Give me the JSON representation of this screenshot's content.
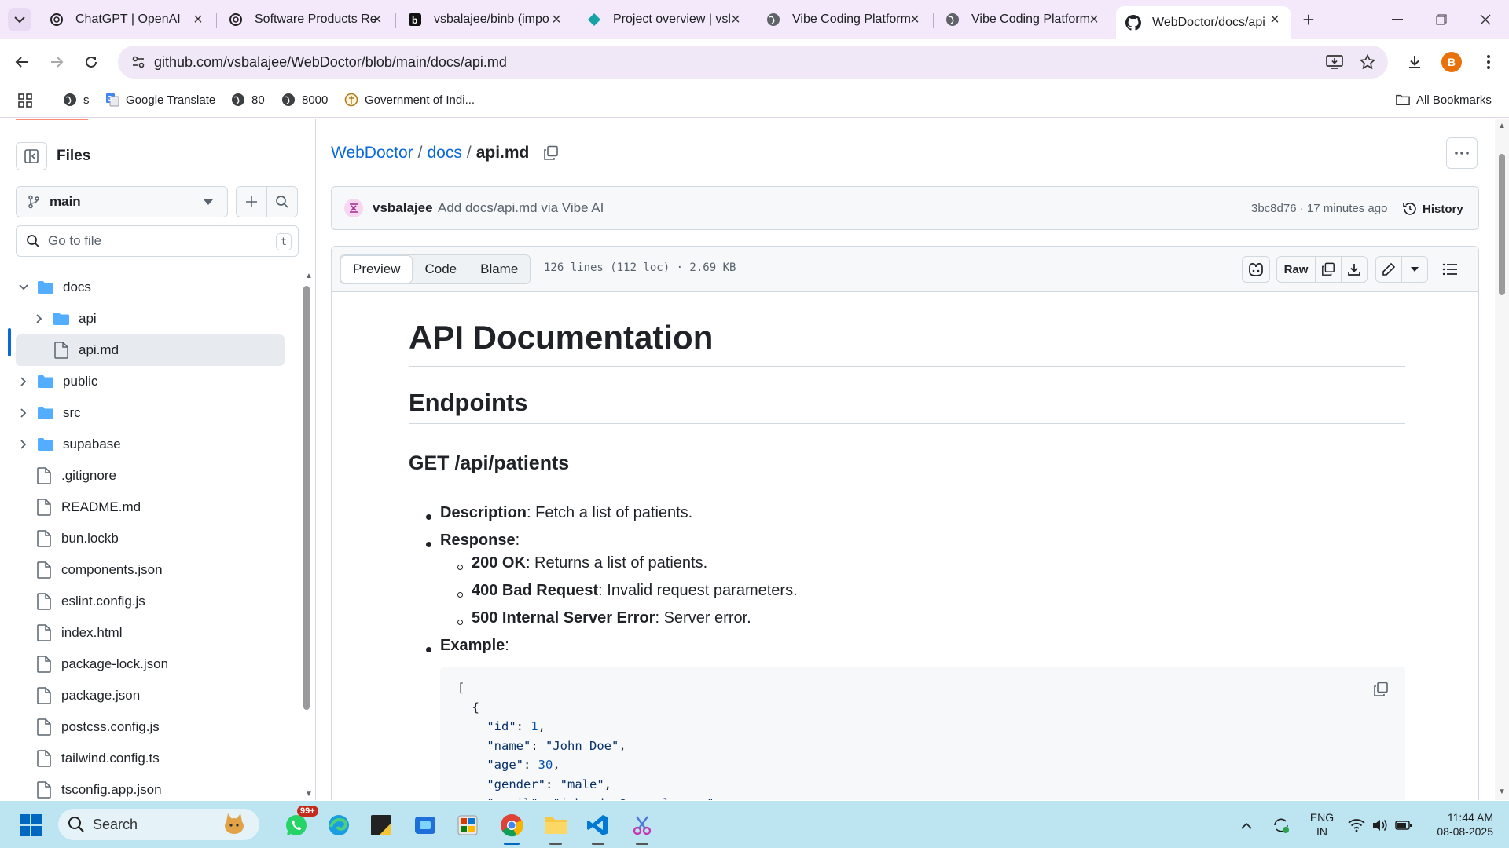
{
  "browser": {
    "tabs": [
      {
        "title": "ChatGPT | OpenAI",
        "icon": "openai-icon"
      },
      {
        "title": "Software Products Re",
        "icon": "openai-icon"
      },
      {
        "title": "vsbalajee/binb (impo",
        "icon": "bolt-icon"
      },
      {
        "title": "Project overview | vsl",
        "icon": "diamond-icon"
      },
      {
        "title": "Vibe Coding Platform",
        "icon": "globe-icon"
      },
      {
        "title": "Vibe Coding Platform",
        "icon": "globe-icon"
      },
      {
        "title": "WebDoctor/docs/api",
        "icon": "github-icon"
      }
    ],
    "url": "github.com/vsbalajee/WebDoctor/blob/main/docs/api.md",
    "profile_initial": "B",
    "bookmarks": [
      {
        "label": "s",
        "icon": "globe-icon"
      },
      {
        "label": "Google Translate",
        "icon": "translate-icon"
      },
      {
        "label": "80",
        "icon": "globe-icon"
      },
      {
        "label": "8000",
        "icon": "globe-icon"
      },
      {
        "label": "Government of Indi...",
        "icon": "emblem-icon"
      }
    ],
    "all_bookmarks": "All Bookmarks"
  },
  "sidebar": {
    "title": "Files",
    "branch": "main",
    "goto_placeholder": "Go to file",
    "goto_shortcut": "t",
    "tree": [
      {
        "label": "docs",
        "type": "folder",
        "expanded": true,
        "depth": 0
      },
      {
        "label": "api",
        "type": "folder",
        "expanded": false,
        "depth": 1
      },
      {
        "label": "api.md",
        "type": "file",
        "selected": true,
        "depth": 1
      },
      {
        "label": "public",
        "type": "folder",
        "expanded": false,
        "depth": 0
      },
      {
        "label": "src",
        "type": "folder",
        "expanded": false,
        "depth": 0
      },
      {
        "label": "supabase",
        "type": "folder",
        "expanded": false,
        "depth": 0
      },
      {
        "label": ".gitignore",
        "type": "file",
        "depth": 0
      },
      {
        "label": "README.md",
        "type": "file",
        "depth": 0
      },
      {
        "label": "bun.lockb",
        "type": "file",
        "depth": 0
      },
      {
        "label": "components.json",
        "type": "file",
        "depth": 0
      },
      {
        "label": "eslint.config.js",
        "type": "file",
        "depth": 0
      },
      {
        "label": "index.html",
        "type": "file",
        "depth": 0
      },
      {
        "label": "package-lock.json",
        "type": "file",
        "depth": 0
      },
      {
        "label": "package.json",
        "type": "file",
        "depth": 0
      },
      {
        "label": "postcss.config.js",
        "type": "file",
        "depth": 0
      },
      {
        "label": "tailwind.config.ts",
        "type": "file",
        "depth": 0
      },
      {
        "label": "tsconfig.app.json",
        "type": "file",
        "depth": 0
      }
    ]
  },
  "breadcrumb": {
    "repo": "WebDoctor",
    "dir": "docs",
    "file": "api.md"
  },
  "commit": {
    "author": "vsbalajee",
    "message": "Add docs/api.md via Vibe AI",
    "meta": "3bc8d76 · 17 minutes ago",
    "history": "History"
  },
  "file": {
    "tabs": [
      "Preview",
      "Code",
      "Blame"
    ],
    "active_tab": "Preview",
    "info": "126 lines (112 loc) · 2.69 KB",
    "raw": "Raw"
  },
  "doc": {
    "h1": "API Documentation",
    "h2": "Endpoints",
    "h3": "GET /api/patients",
    "description_label": "Description",
    "description_text": ": Fetch a list of patients.",
    "response_label": "Response",
    "response_colon": ":",
    "responses": [
      {
        "code": "200 OK",
        "text": ": Returns a list of patients."
      },
      {
        "code": "400 Bad Request",
        "text": ": Invalid request parameters."
      },
      {
        "code": "500 Internal Server Error",
        "text": ": Server error."
      }
    ],
    "example_label": "Example",
    "example_colon": ":",
    "code_lines": [
      {
        "indent": "",
        "key": "",
        "value": "[",
        "vtype": "plain",
        "trail": ""
      },
      {
        "indent": "  ",
        "key": "",
        "value": "{",
        "vtype": "plain",
        "trail": ""
      },
      {
        "indent": "    ",
        "key": "\"id\"",
        "value": "1",
        "vtype": "num",
        "trail": ","
      },
      {
        "indent": "    ",
        "key": "\"name\"",
        "value": "\"John Doe\"",
        "vtype": "str",
        "trail": ","
      },
      {
        "indent": "    ",
        "key": "\"age\"",
        "value": "30",
        "vtype": "num",
        "trail": ","
      },
      {
        "indent": "    ",
        "key": "\"gender\"",
        "value": "\"male\"",
        "vtype": "str",
        "trail": ","
      },
      {
        "indent": "    ",
        "key": "\"email\"",
        "value": "\"john.doe@example.com\"",
        "vtype": "str",
        "trail": ""
      }
    ]
  },
  "taskbar": {
    "search_placeholder": "Search",
    "whatsapp_badge": "99+",
    "lang_line1": "ENG",
    "lang_line2": "IN",
    "time": "11:44 AM",
    "date": "08-08-2025"
  },
  "colors": {
    "link": "#0969da",
    "chrome_bg": "#f3e9fb",
    "taskbar_bg": "#bce4f1",
    "folder": "#54aeff"
  }
}
